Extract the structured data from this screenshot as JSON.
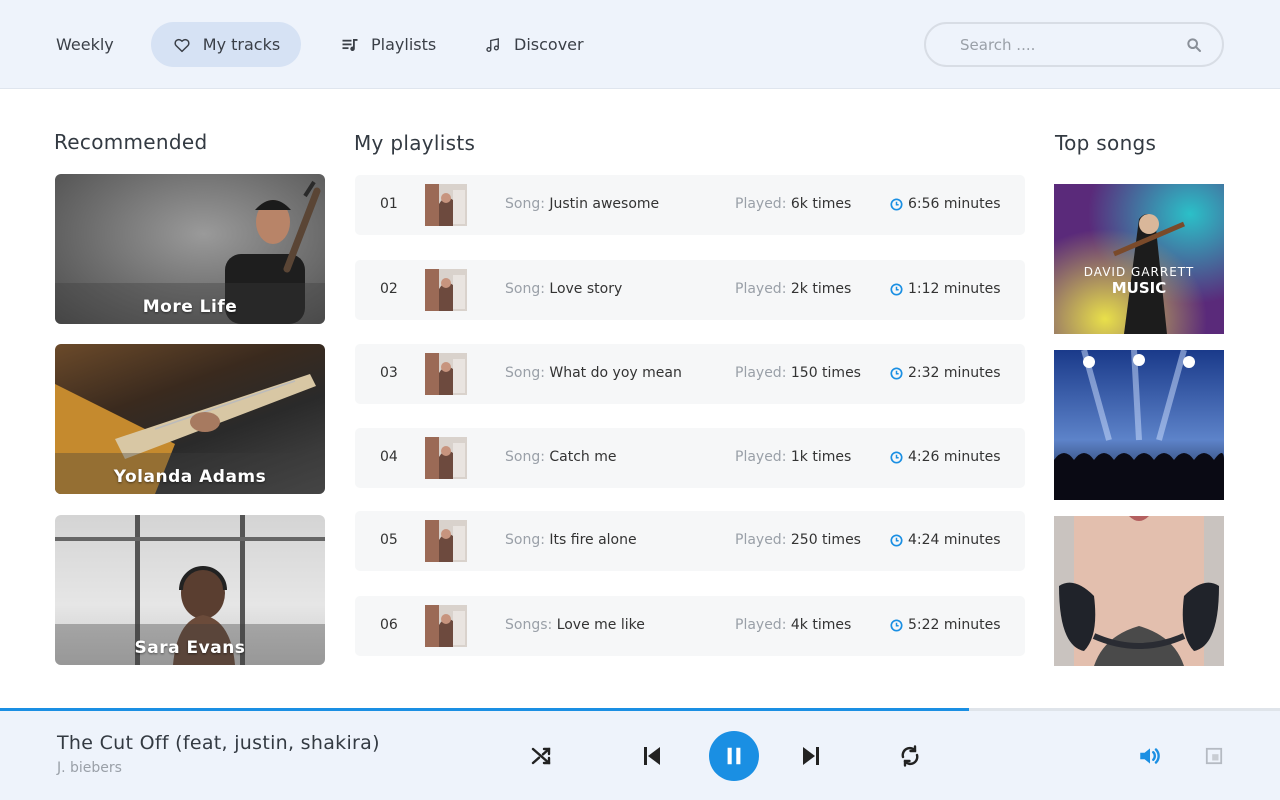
{
  "nav": {
    "weekly": "Weekly",
    "my_tracks": "My tracks",
    "playlists": "Playlists",
    "discover": "Discover"
  },
  "search": {
    "placeholder": "Search ...."
  },
  "recommended": {
    "title": "Recommended",
    "cards": [
      {
        "name": "More Life"
      },
      {
        "name": "Yolanda Adams"
      },
      {
        "name": "Sara Evans"
      }
    ]
  },
  "playlists": {
    "title": "My playlists",
    "rows": [
      {
        "num": "01",
        "song_label": "Song:",
        "song": "Justin awesome",
        "played_label": "Played:",
        "played": "6k times",
        "duration": "6:56 minutes"
      },
      {
        "num": "02",
        "song_label": "Song:",
        "song": "Love story",
        "played_label": "Played:",
        "played": "2k times",
        "duration": "1:12 minutes"
      },
      {
        "num": "03",
        "song_label": "Song:",
        "song": "What do yoy mean",
        "played_label": "Played:",
        "played": "150 times",
        "duration": "2:32 minutes"
      },
      {
        "num": "04",
        "song_label": "Song:",
        "song": "Catch me",
        "played_label": "Played:",
        "played": "1k times",
        "duration": "4:26 minutes"
      },
      {
        "num": "05",
        "song_label": "Song:",
        "song": "Its fire alone",
        "played_label": "Played:",
        "played": "250 times",
        "duration": "4:24 minutes"
      },
      {
        "num": "06",
        "song_label": "Songs:",
        "song": "Love me like",
        "played_label": "Played:",
        "played": "4k times",
        "duration": "5:22 minutes"
      }
    ]
  },
  "top_songs": {
    "title": "Top songs",
    "items": [
      {
        "cover_text": "DAVID GARRETT",
        "cover_subtext": "MUSIC"
      },
      {
        "cover_text": ""
      },
      {
        "cover_text": ""
      }
    ]
  },
  "player": {
    "title": "The Cut Off (feat, justin, shakira)",
    "artist": "J. biebers",
    "progress": 0.757
  },
  "colors": {
    "accent": "#1a8fe3",
    "header_bg": "#eef3fb",
    "active_nav_bg": "#d6e2f4",
    "row_bg": "#f6f7f8"
  },
  "icons": {
    "my_tracks": "heart-icon",
    "playlists": "playlist-icon",
    "discover": "music-note-icon",
    "search": "search-icon",
    "duration": "clock-icon",
    "shuffle": "shuffle-icon",
    "prev": "skip-previous-icon",
    "pause": "pause-icon",
    "next": "skip-next-icon",
    "repeat": "repeat-icon",
    "volume": "volume-icon",
    "expand": "expand-icon"
  }
}
